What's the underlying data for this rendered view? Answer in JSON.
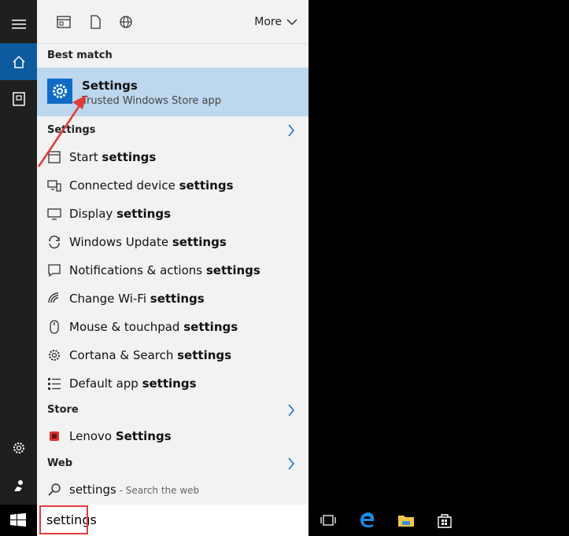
{
  "topbar": {
    "more_label": "More"
  },
  "best_match": {
    "header": "Best match",
    "title": "Settings",
    "subtitle": "Trusted Windows Store app"
  },
  "settings_section": {
    "header": "Settings",
    "items": [
      {
        "prefix": "Start ",
        "bold": "settings",
        "icon": "start-icon"
      },
      {
        "prefix": "Connected device ",
        "bold": "settings",
        "icon": "device-icon"
      },
      {
        "prefix": "Display ",
        "bold": "settings",
        "icon": "display-icon"
      },
      {
        "prefix": "Windows Update ",
        "bold": "settings",
        "icon": "update-icon"
      },
      {
        "prefix": "Notifications & actions ",
        "bold": "settings",
        "icon": "notifications-icon"
      },
      {
        "prefix": "Change Wi-Fi ",
        "bold": "settings",
        "icon": "wifi-icon"
      },
      {
        "prefix": "Mouse & touchpad ",
        "bold": "settings",
        "icon": "mouse-icon"
      },
      {
        "prefix": "Cortana & Search ",
        "bold": "settings",
        "icon": "gear-icon"
      },
      {
        "prefix": "Default app ",
        "bold": "settings",
        "icon": "default-apps-icon"
      }
    ]
  },
  "store_section": {
    "header": "Store",
    "items": [
      {
        "prefix": "Lenovo ",
        "bold": "Settings",
        "icon": "lenovo-icon"
      }
    ]
  },
  "web_section": {
    "header": "Web",
    "items": [
      {
        "query": "settings",
        "hint": " - Search the web",
        "icon": "search-icon"
      }
    ]
  },
  "search": {
    "value": "settings"
  },
  "colors": {
    "accent": "#0e6cc7",
    "highlight": "#bcd7ee",
    "annotation": "#e23b3b"
  }
}
